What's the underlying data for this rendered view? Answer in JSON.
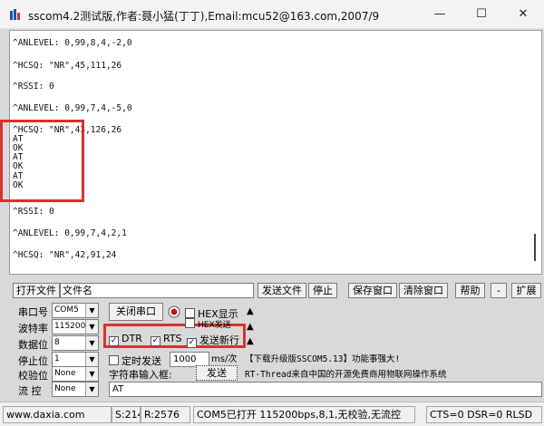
{
  "window": {
    "title": "sscom4.2测试版,作者:聂小猛(丁丁),Email:mcu52@163.com,2007/9",
    "minimize": "—",
    "maximize": "☐",
    "close": "✕"
  },
  "terminal": {
    "lines": [
      "^ANLEVEL: 0,99,8,4,-2,0",
      "^HCSQ: \"NR\",45,111,26",
      "^RSSI: 0",
      "^ANLEVEL: 0,99,7,4,-5,0",
      "^HCSQ: \"NR\",43,126,26",
      "AT",
      "OK",
      "AT",
      "OK",
      "AT",
      "OK",
      "^RSSI: 0",
      "^ANLEVEL: 0,99,7,4,2,1",
      "^HCSQ: \"NR\",42,91,24"
    ]
  },
  "toolbar": {
    "open_file": "打开文件",
    "file_name": "文件名",
    "send_file": "发送文件",
    "stop": "停止",
    "save_window": "保存窗口",
    "clear_window": "清除窗口",
    "help": "帮助",
    "minus": "-",
    "expand": "扩展"
  },
  "settings": {
    "port_label": "串口号",
    "port_value": "COM5",
    "baud_label": "波特率",
    "baud_value": "115200",
    "databits_label": "数据位",
    "databits_value": "8",
    "stopbits_label": "停止位",
    "stopbits_value": "1",
    "parity_label": "校验位",
    "parity_value": "None",
    "flow_label": "流 控",
    "flow_value": "None"
  },
  "controls": {
    "close_port": "关闭串口",
    "hex_display": "HEX显示",
    "hex_send": "HEX发送",
    "dtr": "DTR",
    "rts": "RTS",
    "send_newline": "发送新行",
    "timed_send": "定时发送",
    "interval": "1000",
    "interval_unit": "ms/次",
    "string_input_label": "字符串输入框:",
    "send_button": "发送",
    "input_value": "AT"
  },
  "info": {
    "line1": "【下载升级版SSCOM5.13】功能事强大!",
    "line2": "RT-Thread来自中国的开源免费商用物联网操作系统"
  },
  "status": {
    "website": "www.daxia.com",
    "sent": "S:214",
    "received": "R:2576",
    "port_status": "COM5已打开  115200bps,8,1,无校验,无流控",
    "signals": "CTS=0 DSR=0 RLSD"
  },
  "colors": {
    "highlight": "#d7322f",
    "record_button": "#c01818"
  }
}
